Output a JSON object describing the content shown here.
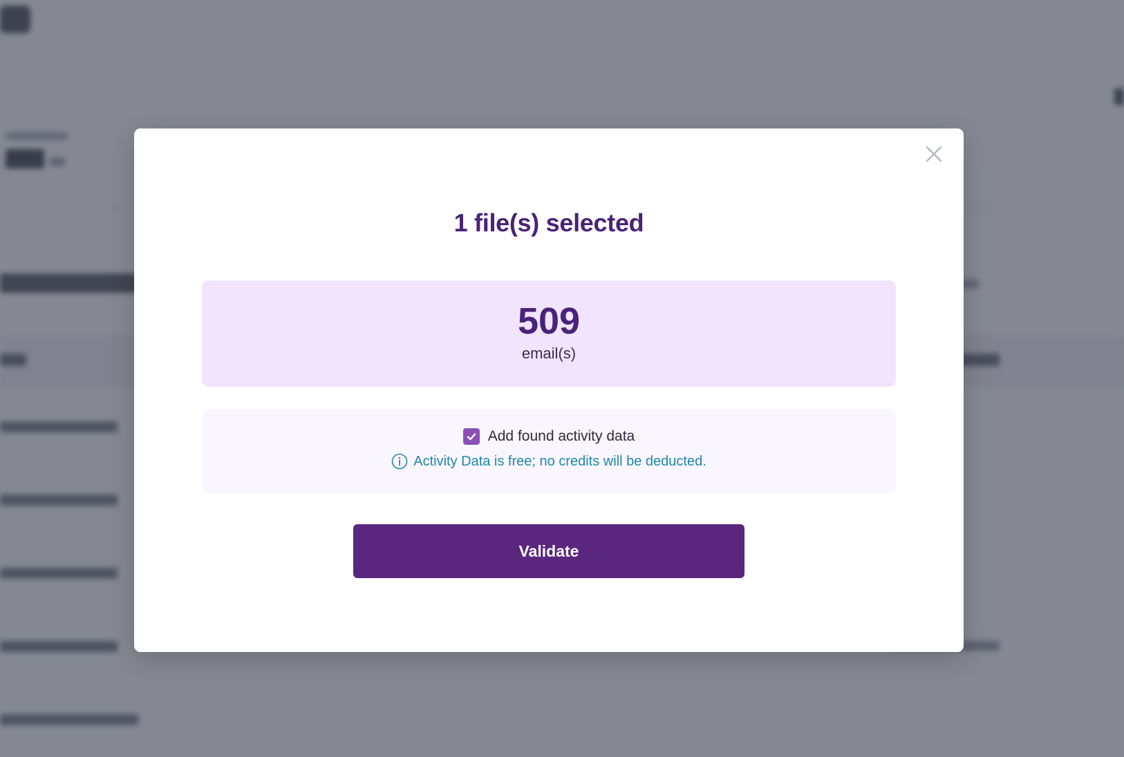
{
  "modal": {
    "title": "1 file(s) selected",
    "count": {
      "value": "509",
      "label": "email(s)"
    },
    "activity_option": {
      "checked": true,
      "label": "Add found activity data",
      "info": "Activity Data is free; no credits will be deducted."
    },
    "validate_label": "Validate"
  },
  "colors": {
    "accent": "#5b267e",
    "title": "#4a2279",
    "count_box_bg": "#f0e5fd",
    "checkbox": "#8c4fb8",
    "info": "#1e88a8",
    "overlay": "#404654"
  },
  "icons": {
    "close": "close-icon",
    "check": "check-icon",
    "info": "info-icon"
  }
}
